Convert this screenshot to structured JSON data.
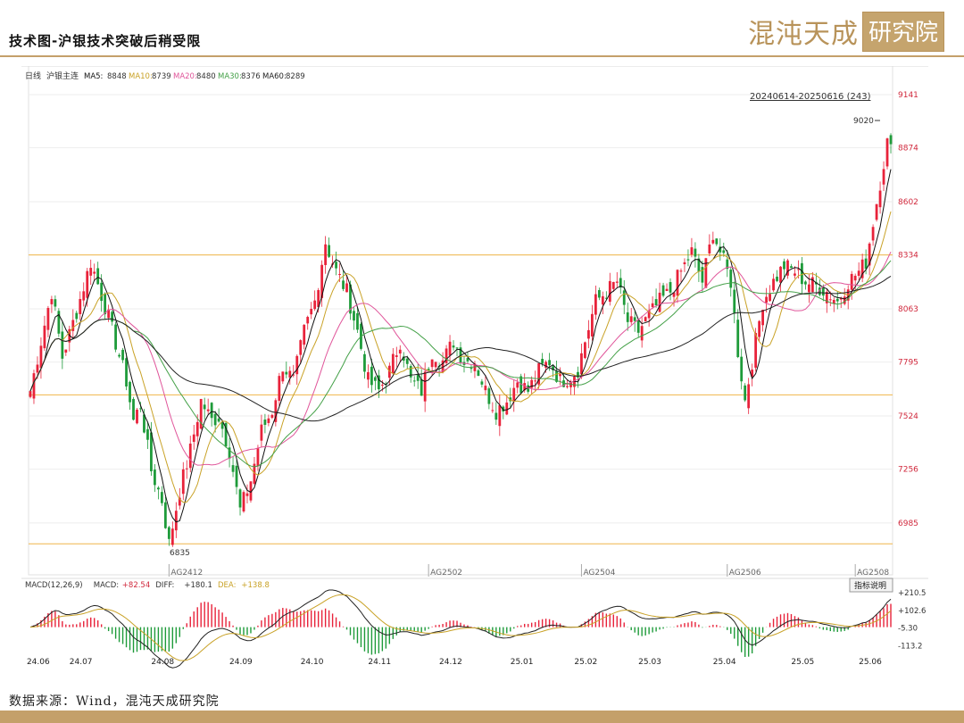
{
  "header": {
    "title": "技术图-沪银技术突破后稍受限",
    "logo_main": "混沌天成",
    "logo_box": "研究院"
  },
  "footer": {
    "source": "数据来源：Wind，混沌天成研究院"
  },
  "colors": {
    "up": "#e8223a",
    "down": "#1e9b3a",
    "ma5": "#111111",
    "ma10": "#c9a227",
    "ma20": "#e0559a",
    "ma30": "#43a047",
    "ma60": "#222222",
    "hline": "#f0b64a",
    "accent": "#c4a06a"
  },
  "chart_data": {
    "type": "candlestick",
    "legend": {
      "period": "日线",
      "symbol": "沪银主连",
      "items": [
        {
          "label": "MA5:",
          "value": "8848"
        },
        {
          "label": "MA10:",
          "value": "8739"
        },
        {
          "label": "MA20:",
          "value": "8480"
        },
        {
          "label": "MA30:",
          "value": "8376"
        },
        {
          "label": "MA60:",
          "value": "8289"
        }
      ]
    },
    "range_label": "20240614-20250616 (243)",
    "annotations": {
      "high": "9020",
      "low": "6835"
    },
    "y_ticks": [
      "9141",
      "8874",
      "8602",
      "8334",
      "8063",
      "7795",
      "7524",
      "7256",
      "6985"
    ],
    "ylim": [
      6760,
      9195
    ],
    "horizontal_lines": [
      8334,
      7630,
      6880
    ],
    "contract_labels": [
      {
        "label": "AG2412",
        "index": 39
      },
      {
        "label": "AG2502",
        "index": 112
      },
      {
        "label": "AG2504",
        "index": 155
      },
      {
        "label": "AG2506",
        "index": 196
      },
      {
        "label": "AG2508",
        "index": 232
      }
    ],
    "x_ticks": [
      {
        "label": "24.06",
        "index": 2
      },
      {
        "label": "24.07",
        "index": 14
      },
      {
        "label": "24.08",
        "index": 37
      },
      {
        "label": "24.09",
        "index": 59
      },
      {
        "label": "24.10",
        "index": 79
      },
      {
        "label": "24.11",
        "index": 98
      },
      {
        "label": "24.12",
        "index": 118
      },
      {
        "label": "25.01",
        "index": 138
      },
      {
        "label": "25.02",
        "index": 156
      },
      {
        "label": "25.03",
        "index": 174
      },
      {
        "label": "25.04",
        "index": 195
      },
      {
        "label": "25.05",
        "index": 217
      },
      {
        "label": "25.06",
        "index": 236
      }
    ],
    "bar_count": 243,
    "anchors": [
      [
        0,
        7650
      ],
      [
        3,
        7900
      ],
      [
        6,
        8150
      ],
      [
        9,
        7820
      ],
      [
        13,
        8050
      ],
      [
        17,
        8300
      ],
      [
        22,
        8020
      ],
      [
        27,
        7700
      ],
      [
        29,
        7500
      ],
      [
        31,
        7580
      ],
      [
        34,
        7250
      ],
      [
        37,
        7100
      ],
      [
        39,
        6880
      ],
      [
        42,
        7150
      ],
      [
        45,
        7350
      ],
      [
        48,
        7600
      ],
      [
        51,
        7500
      ],
      [
        53,
        7520
      ],
      [
        56,
        7350
      ],
      [
        59,
        7050
      ],
      [
        62,
        7200
      ],
      [
        65,
        7450
      ],
      [
        68,
        7550
      ],
      [
        71,
        7780
      ],
      [
        74,
        7700
      ],
      [
        77,
        7950
      ],
      [
        80,
        8100
      ],
      [
        83,
        8400
      ],
      [
        86,
        8250
      ],
      [
        89,
        8150
      ],
      [
        92,
        7950
      ],
      [
        95,
        7700
      ],
      [
        98,
        7650
      ],
      [
        101,
        7750
      ],
      [
        104,
        7900
      ],
      [
        107,
        7700
      ],
      [
        110,
        7650
      ],
      [
        113,
        7850
      ],
      [
        116,
        7800
      ],
      [
        119,
        7900
      ],
      [
        122,
        7800
      ],
      [
        125,
        7800
      ],
      [
        128,
        7650
      ],
      [
        131,
        7550
      ],
      [
        134,
        7600
      ],
      [
        137,
        7700
      ],
      [
        140,
        7650
      ],
      [
        143,
        7750
      ],
      [
        146,
        7800
      ],
      [
        149,
        7700
      ],
      [
        152,
        7720
      ],
      [
        154,
        7760
      ],
      [
        156,
        7900
      ],
      [
        159,
        8100
      ],
      [
        162,
        8150
      ],
      [
        165,
        8200
      ],
      [
        168,
        8000
      ],
      [
        171,
        7950
      ],
      [
        174,
        8030
      ],
      [
        177,
        8100
      ],
      [
        180,
        8150
      ],
      [
        183,
        8250
      ],
      [
        186,
        8350
      ],
      [
        189,
        8200
      ],
      [
        192,
        8450
      ],
      [
        195,
        8300
      ],
      [
        197,
        8200
      ],
      [
        199,
        7850
      ],
      [
        201,
        7600
      ],
      [
        203,
        7800
      ],
      [
        206,
        8100
      ],
      [
        209,
        8200
      ],
      [
        212,
        8280
      ],
      [
        215,
        8250
      ],
      [
        218,
        8200
      ],
      [
        221,
        8180
      ],
      [
        224,
        8150
      ],
      [
        227,
        8100
      ],
      [
        230,
        8200
      ],
      [
        233,
        8250
      ],
      [
        235,
        8300
      ],
      [
        237,
        8500
      ],
      [
        239,
        8700
      ],
      [
        241,
        8900
      ],
      [
        242,
        8860
      ]
    ],
    "macd": {
      "label": "MACD(12,26,9)",
      "macd_label": "MACD:",
      "macd_value": "+82.54",
      "diff_label": "DIFF:",
      "diff_value": "+180.1",
      "dea_label": "DEA:",
      "dea_value": "+138.8",
      "y_ticks": [
        "+210.5",
        "+102.6",
        "-5.30",
        "-113.2"
      ],
      "ylim": [
        -150,
        255
      ]
    },
    "button_label": "指标说明"
  }
}
